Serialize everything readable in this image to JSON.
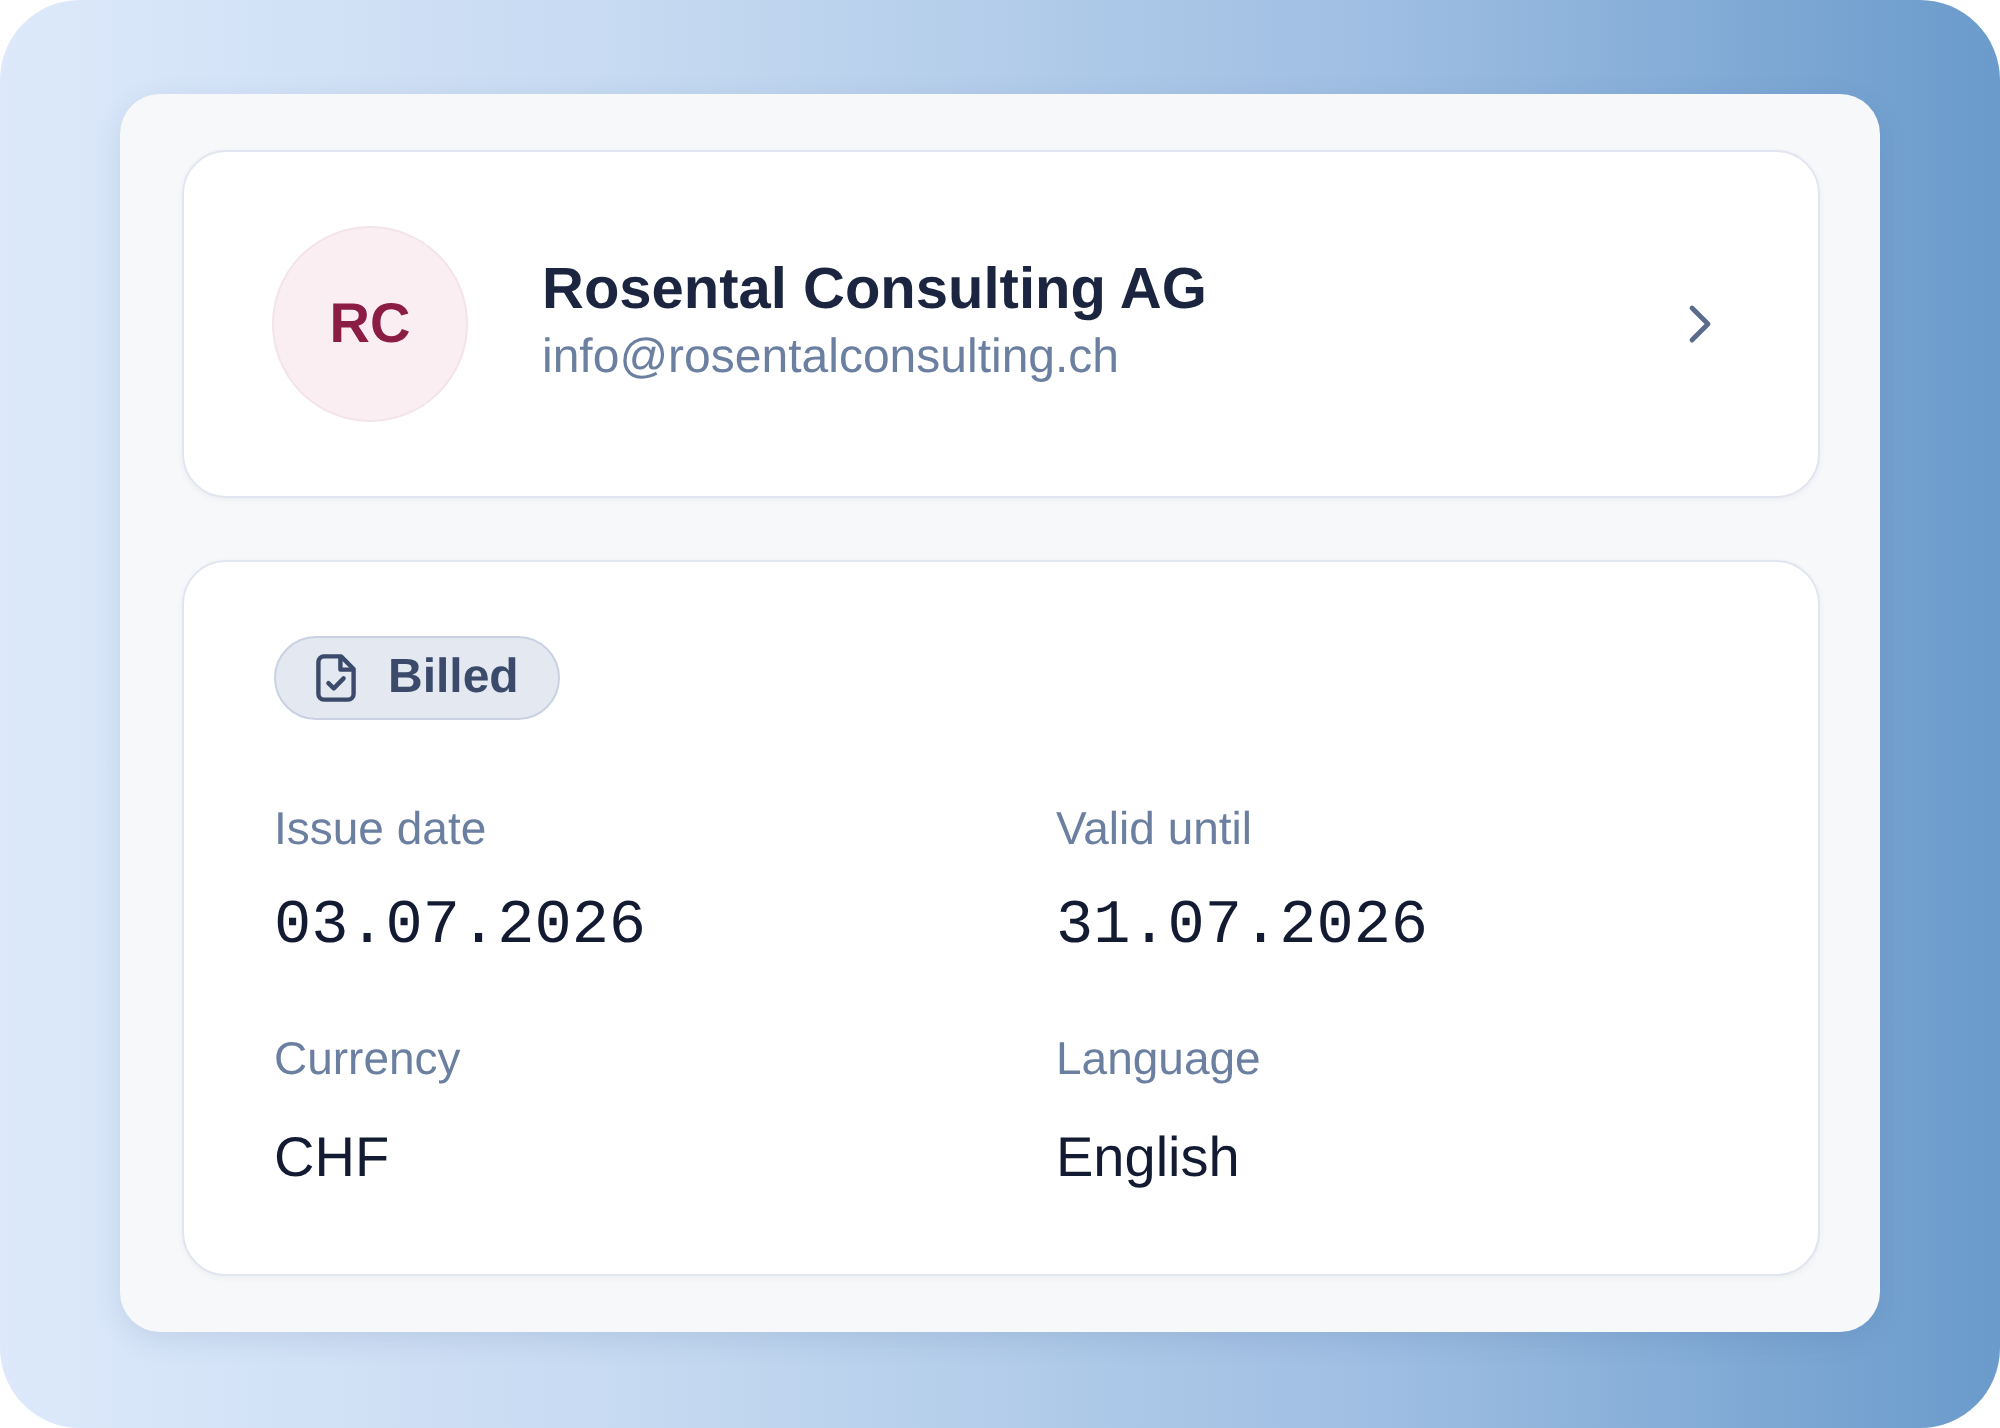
{
  "customer": {
    "initials": "RC",
    "name": "Rosental Consulting AG",
    "email": "info@rosentalconsulting.ch"
  },
  "status": {
    "label": "Billed"
  },
  "fields": [
    {
      "label": "Issue date",
      "value": "03.07.2026",
      "kind": "date"
    },
    {
      "label": "Valid until",
      "value": "31.07.2026",
      "kind": "date"
    },
    {
      "label": "Currency",
      "value": "CHF",
      "kind": "text"
    },
    {
      "label": "Language",
      "value": "English",
      "kind": "text"
    }
  ]
}
